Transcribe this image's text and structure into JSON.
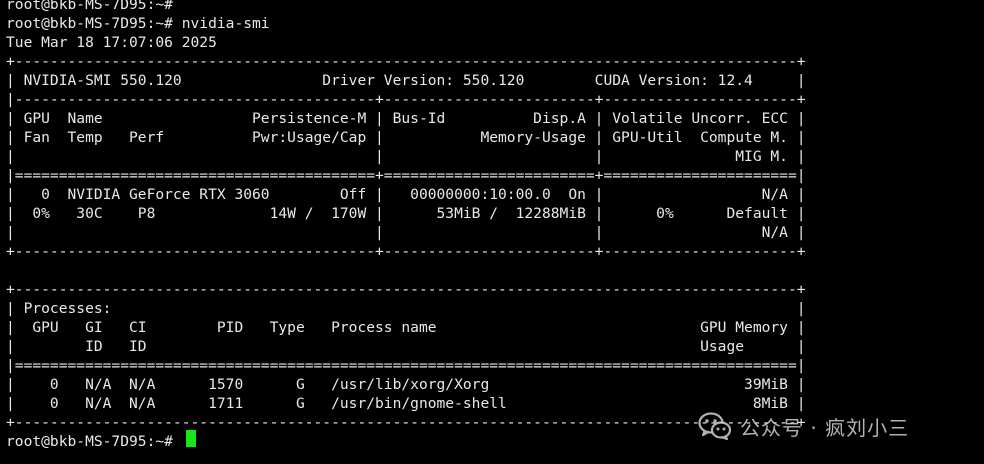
{
  "terminal": {
    "lines": [
      "root@bkb-MS-7D95:~#",
      "root@bkb-MS-7D95:~# nvidia-smi",
      "Tue Mar 18 17:07:06 2025",
      "+-----------------------------------------------------------------------------------------+",
      "| NVIDIA-SMI 550.120                Driver Version: 550.120        CUDA Version: 12.4     |",
      "|-----------------------------------------+------------------------+----------------------+",
      "| GPU  Name                 Persistence-M | Bus-Id          Disp.A | Volatile Uncorr. ECC |",
      "| Fan  Temp   Perf          Pwr:Usage/Cap |           Memory-Usage | GPU-Util  Compute M. |",
      "|                                         |                        |               MIG M. |",
      "|=========================================+========================+======================|",
      "|   0  NVIDIA GeForce RTX 3060        Off |   00000000:10:00.0  On |                  N/A |",
      "|  0%   30C    P8             14W /  170W |      53MiB /  12288MiB |      0%      Default |",
      "|                                         |                        |                  N/A |",
      "+-----------------------------------------+------------------------+----------------------+",
      "",
      "+-----------------------------------------------------------------------------------------+",
      "| Processes:                                                                              |",
      "|  GPU   GI   CI        PID   Type   Process name                              GPU Memory |",
      "|        ID   ID                                                               Usage      |",
      "|=========================================================================================|",
      "|    0   N/A  N/A      1570      G   /usr/lib/xorg/Xorg                             39MiB |",
      "|    0   N/A  N/A      1711      G   /usr/bin/gnome-shell                            8MiB |",
      "+-----------------------------------------------------------------------------------------+",
      "root@bkb-MS-7D95:~# "
    ],
    "cursor_color": "#19e619",
    "text_color": "#e8e8e8",
    "background": "#000000"
  },
  "watermark": {
    "icon": "wechat-icon",
    "text": "公众号 · 疯刘小三"
  }
}
